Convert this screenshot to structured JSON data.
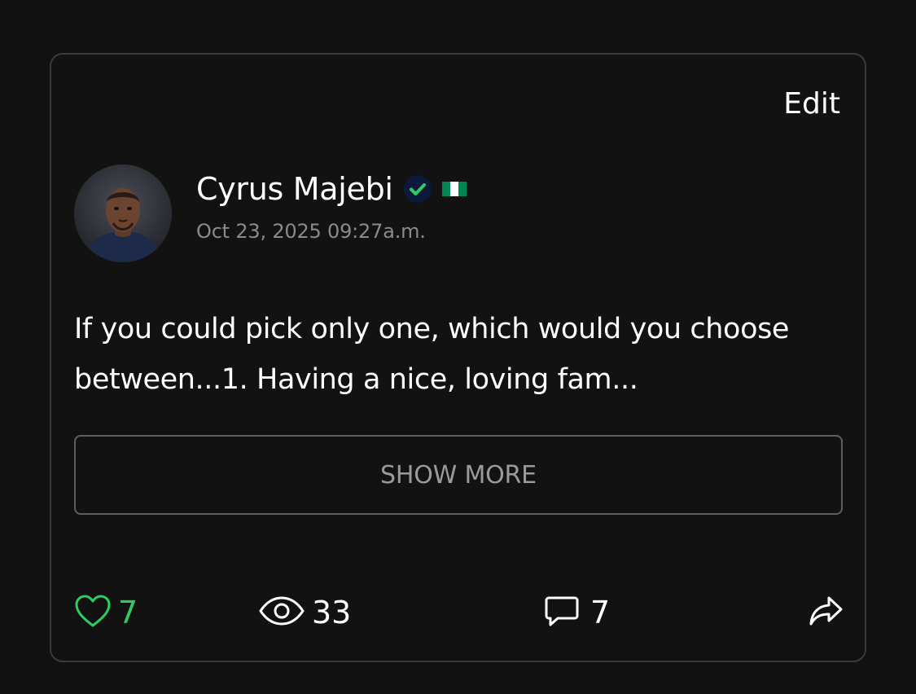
{
  "post": {
    "edit_label": "Edit",
    "author": {
      "name": "Cyrus Majebi",
      "verified_icon": "verified-check-icon",
      "flag": "nigeria-flag"
    },
    "timestamp": "Oct 23, 2025 09:27a.m.",
    "text": "If you could pick only one, which would you choose between...1. Having a nice, loving fam...",
    "show_more_label": "SHOW MORE",
    "stats": {
      "likes": "7",
      "views": "33",
      "comments": "7"
    }
  },
  "colors": {
    "background": "#111111",
    "card_border": "#3a3a3a",
    "like_green": "#2ecc60",
    "verified_green": "#2ecc60",
    "muted_text": "#8a8a8a",
    "flag_green": "#008751"
  },
  "icons": {
    "like": "heart-outline-icon",
    "views": "eye-icon",
    "comments": "comment-bubble-icon",
    "share": "share-arrow-icon"
  }
}
